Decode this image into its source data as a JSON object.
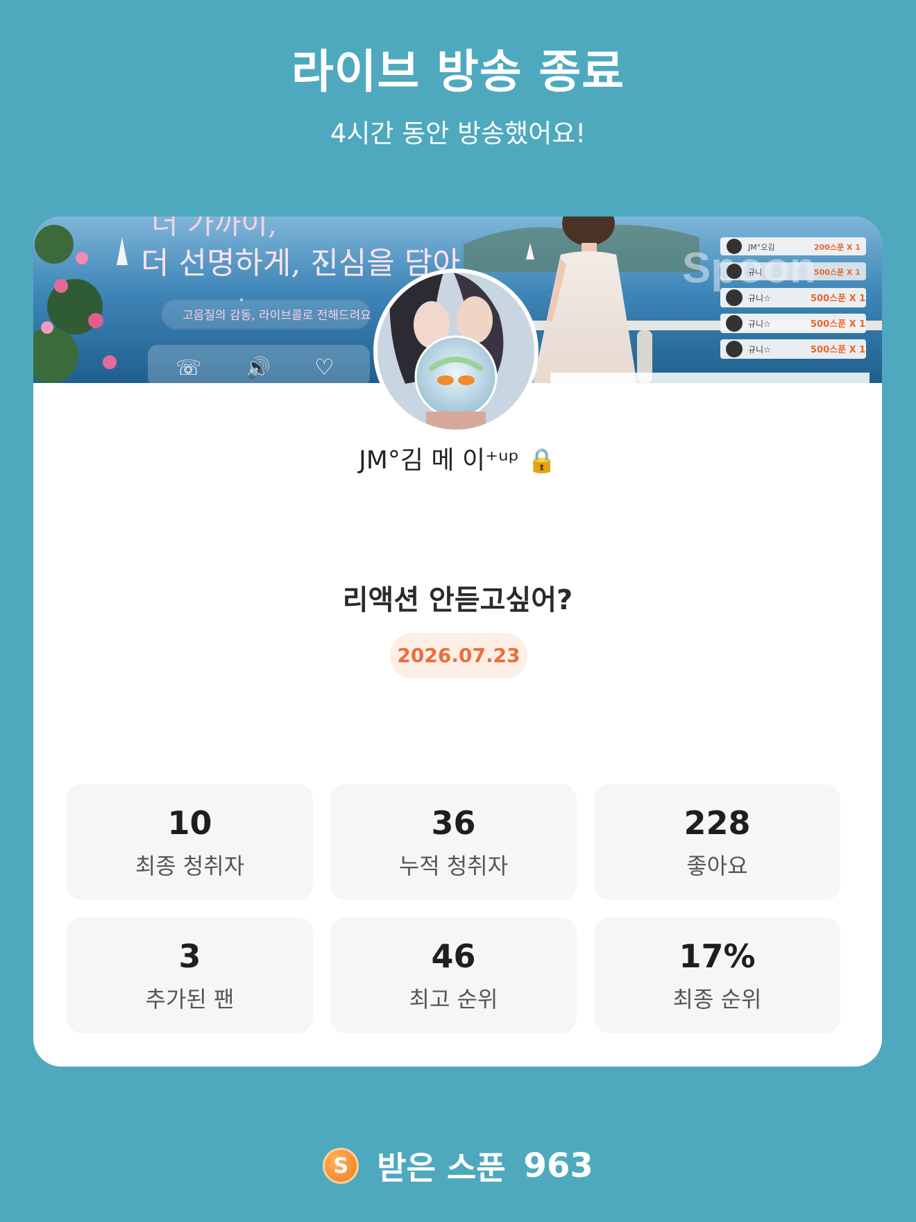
{
  "header": {
    "title": "라이브 방송 종료",
    "subtitle": "4시간 동안 방송했어요!"
  },
  "banner": {
    "headline_top": "더 가까이,",
    "headline": "더 선명하게, 진심을 담아",
    "tagline": "고음질의 감동, 라이브콜로 전해드려요",
    "brand": "Spoon",
    "gift_list": [
      {
        "user": "JM°오김",
        "gift": "200스푼 X 1"
      },
      {
        "user": "규니",
        "gift": "500스푼 X 1"
      },
      {
        "user": "규니☆",
        "gift": "500스푼 X 1"
      },
      {
        "user": "규니☆",
        "gift": "500스푼 X 1"
      },
      {
        "user": "규니☆",
        "gift": "500스푼 X 1"
      }
    ]
  },
  "profile": {
    "nickname": "JM°김 메 이⁺ᵘᵖ",
    "lock_icon": "🔒"
  },
  "room": {
    "title": "리액션 안듣고싶어?",
    "date": "2026.07.23"
  },
  "stats": [
    {
      "value": "10",
      "label": "최종 청취자"
    },
    {
      "value": "36",
      "label": "누적 청취자"
    },
    {
      "value": "228",
      "label": "좋아요"
    },
    {
      "value": "3",
      "label": "추가된 팬"
    },
    {
      "value": "46",
      "label": "최고 순위"
    },
    {
      "value": "17%",
      "label": "최종 순위"
    }
  ],
  "spoons": {
    "icon_letter": "S",
    "label": "받은 스푼",
    "count": "963"
  },
  "colors": {
    "background": "#4ea9bf",
    "card": "#ffffff",
    "stat_box": "#f6f6f6",
    "date_text": "#e86f3c",
    "date_bg": "#fdeee6",
    "spoon_orange": "#f07a1e"
  }
}
